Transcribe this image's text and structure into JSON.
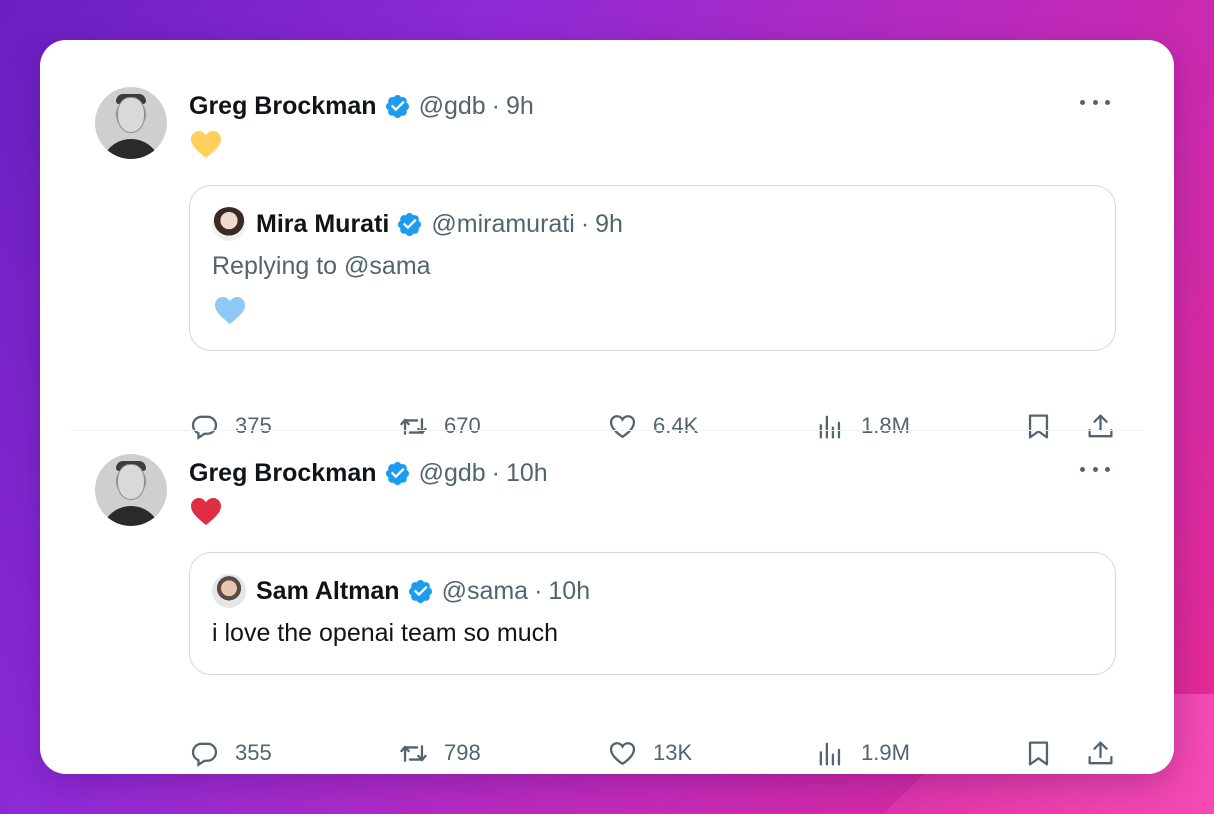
{
  "tweets": [
    {
      "author_name": "Greg Brockman",
      "handle": "@gdb",
      "separator": "·",
      "time": "9h",
      "emoji": "yellow-heart",
      "emoji_color": "#ffd05b",
      "quote": {
        "author_name": "Mira Murati",
        "handle": "@miramurati",
        "separator": "·",
        "time": "9h",
        "replying_prefix": "Replying to",
        "replying_handle": "@sama",
        "emoji": "light-blue-heart",
        "emoji_color": "#8dc8f7"
      },
      "stats": {
        "replies": "375",
        "retweets": "670",
        "likes": "6.4K",
        "views": "1.8M"
      }
    },
    {
      "author_name": "Greg Brockman",
      "handle": "@gdb",
      "separator": "·",
      "time": "10h",
      "emoji": "red-heart",
      "emoji_color": "#dd2e44",
      "quote": {
        "author_name": "Sam Altman",
        "handle": "@sama",
        "separator": "·",
        "time": "10h",
        "text": "i love the openai team so much"
      },
      "stats": {
        "replies": "355",
        "retweets": "798",
        "likes": "13K",
        "views": "1.9M"
      }
    }
  ],
  "colors": {
    "verified": "#1d9bf0",
    "secondary_text": "#536471",
    "primary_text": "#0f1419"
  },
  "icons": [
    "verified-badge-icon",
    "more-icon",
    "reply-icon",
    "retweet-icon",
    "like-icon",
    "views-icon",
    "bookmark-icon",
    "share-icon"
  ]
}
